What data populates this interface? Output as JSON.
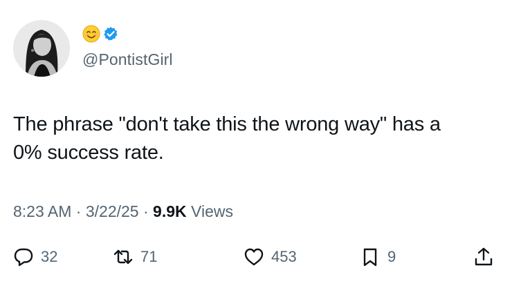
{
  "user": {
    "handle": "@PontistGirl",
    "badge_icon": "verified-badge-icon",
    "emoji_icon": "smiling-face-emoji-icon",
    "badge_color": "#1d9bf0"
  },
  "tweet": {
    "text_line1": "The phrase \"don't take this the wrong way\" has a",
    "text_line2": "0% success rate."
  },
  "meta": {
    "time": "8:23 AM",
    "separator1": " · ",
    "date": "3/22/25",
    "separator2": " · ",
    "views_count": "9.9K",
    "views_label": " Views"
  },
  "actions": {
    "reply_count": "32",
    "retweet_count": "71",
    "like_count": "453",
    "bookmark_count": "9"
  },
  "colors": {
    "text_primary": "#0f1419",
    "text_secondary": "#536471",
    "accent": "#1d9bf0"
  }
}
